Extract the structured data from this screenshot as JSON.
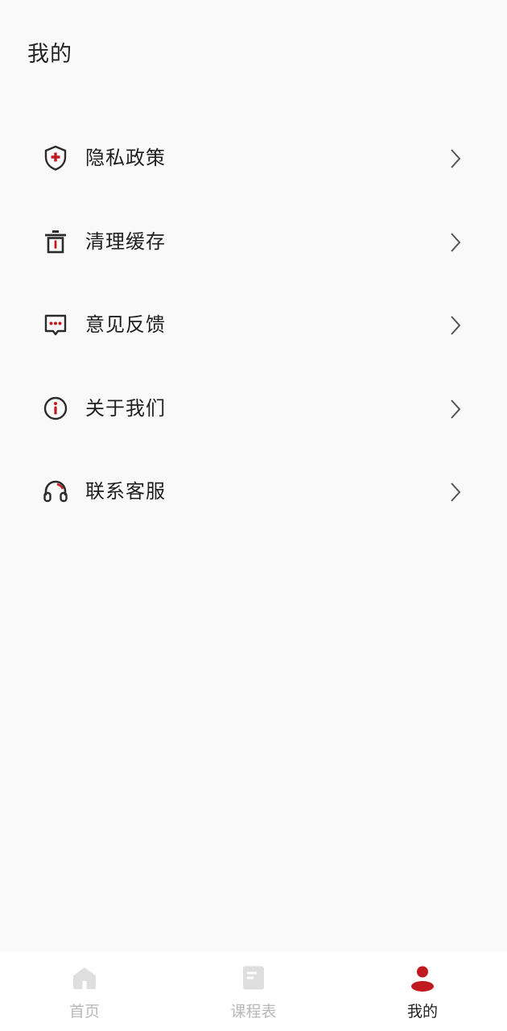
{
  "header": {
    "title": "我的"
  },
  "menu": {
    "items": [
      {
        "label": "隐私政策",
        "icon": "shield-plus-icon"
      },
      {
        "label": "清理缓存",
        "icon": "trash-icon"
      },
      {
        "label": "意见反馈",
        "icon": "chat-bubble-icon"
      },
      {
        "label": "关于我们",
        "icon": "info-circle-icon"
      },
      {
        "label": "联系客服",
        "icon": "headphones-icon"
      }
    ],
    "chevron_icon": "chevron-right-icon"
  },
  "tabbar": {
    "tabs": [
      {
        "label": "首页",
        "icon": "home-icon",
        "active": false
      },
      {
        "label": "课程表",
        "icon": "schedule-icon",
        "active": false
      },
      {
        "label": "我的",
        "icon": "user-icon",
        "active": true
      }
    ]
  },
  "colors": {
    "accent": "#c0191f",
    "icon_dark": "#2b2b2b",
    "tab_inactive": "#b8b8b8",
    "tab_icon_inactive": "#dedede",
    "background": "#f9f9f9"
  }
}
